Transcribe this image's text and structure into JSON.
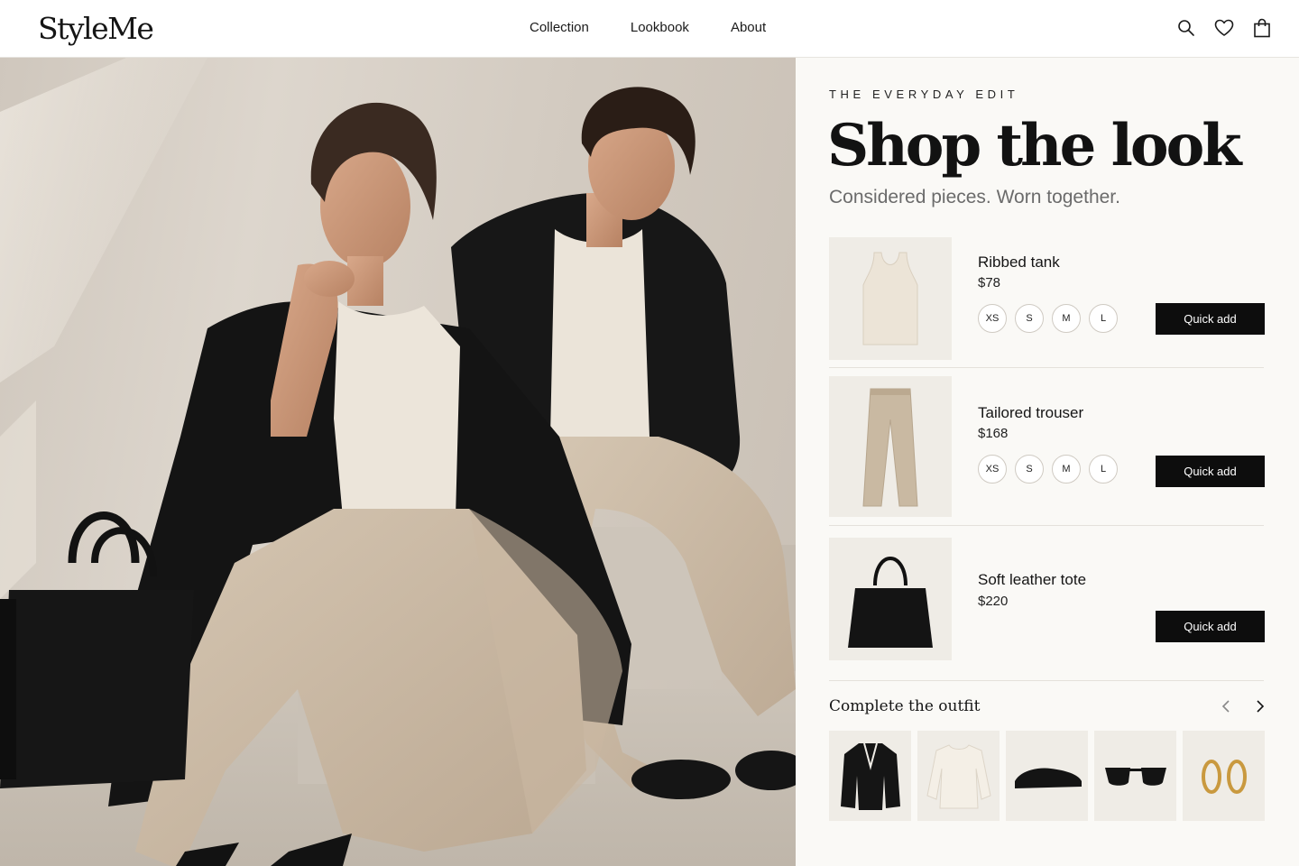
{
  "header": {
    "logo": "StyleMe",
    "nav": [
      "Collection",
      "Lookbook",
      "About"
    ],
    "icons": [
      "search-icon",
      "heart-icon",
      "bag-icon"
    ]
  },
  "hero": {
    "image": "editorial photo: two models in neutral outfits sitting on concrete blocks"
  },
  "panel": {
    "eyebrow": "THE EVERYDAY EDIT",
    "headline": "Shop the look",
    "subhead": "Considered pieces. Worn together.",
    "products": [
      {
        "name": "Ribbed tank",
        "price": "$78",
        "sizes": [
          "XS",
          "S",
          "M",
          "L"
        ],
        "cta": "Quick add",
        "icon": "tank-top-icon"
      },
      {
        "name": "Tailored trouser",
        "price": "$168",
        "sizes": [
          "XS",
          "S",
          "M",
          "L"
        ],
        "cta": "Quick add",
        "icon": "trouser-icon"
      },
      {
        "name": "Soft leather tote",
        "price": "$220",
        "cta": "Quick add",
        "icon": "tote-bag-icon"
      }
    ],
    "outfit": {
      "title": "Complete the outfit",
      "prev_icon": "chevron-left-icon",
      "next_icon": "chevron-right-icon",
      "items": [
        "blazer-icon",
        "sweater-icon",
        "loafer-icon",
        "sunglasses-icon",
        "earrings-icon"
      ]
    }
  },
  "colors": {
    "accent": "#0d0d0d",
    "panel_bg": "#faf9f6",
    "thumb_bg": "#efece6",
    "muted_text": "#6b6b6b"
  }
}
